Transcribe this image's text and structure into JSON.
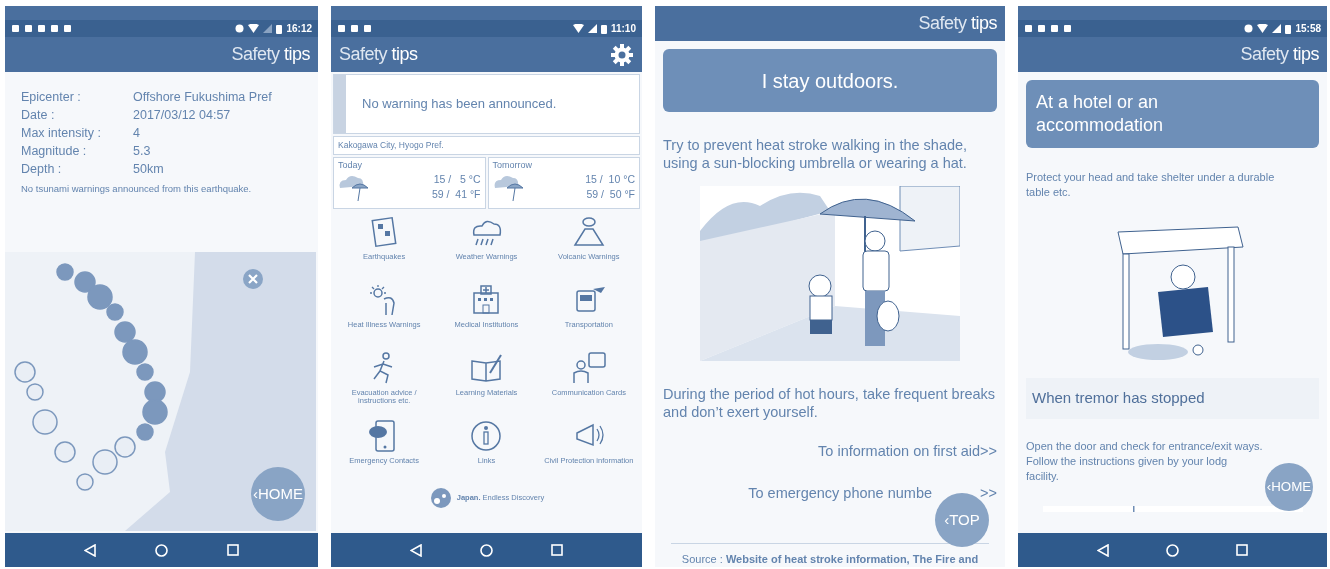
{
  "screens": [
    {
      "kind": "earthquake",
      "status_bar": {
        "time": "16:12"
      },
      "app_title": "Safety **tips**",
      "details": [
        {
          "label": "Epicenter :",
          "value": "Offshore Fukushima Pref"
        },
        {
          "label": "Date :",
          "value": "2017/03/12 04:57"
        },
        {
          "label": "Max intensity :",
          "value": "4"
        },
        {
          "label": "Magnitude :",
          "value": "5.3"
        },
        {
          "label": "Depth :",
          "value": "50km"
        }
      ],
      "note": "No tsunami warnings announced from this earthquake.",
      "map": {
        "kind": "picture"
      },
      "float_button": "‹HOME",
      "nav_bar": true
    },
    {
      "kind": "home",
      "status_bar": {
        "time": "11:10"
      },
      "app_title": "Safety **tips**",
      "warning": "No warning has been announced.",
      "location": "Kakogawa City, Hyogo Pref.",
      "forecast": [
        {
          "day": "Today",
          "celsius": "15 /   5 °C",
          "fahrenheit": "59 /  41 °F"
        },
        {
          "day": "Tomorrow",
          "celsius": "15 /  10 °C",
          "fahrenheit": "59 /  50 °F"
        }
      ],
      "menu": [
        {
          "label": "Earthquakes"
        },
        {
          "label": "Weather Warnings"
        },
        {
          "label": "Volcanic Warnings"
        },
        {
          "label": "Heat Illness Warnings"
        },
        {
          "label": "Medical Institutions"
        },
        {
          "label": "Transportation"
        },
        {
          "label": "Evacuation advice / instructions etc."
        },
        {
          "label": "Learning Materials"
        },
        {
          "label": "Communication Cards"
        },
        {
          "label": "Emergency Contacts"
        },
        {
          "label": "Links"
        },
        {
          "label": "Civil Protection information"
        }
      ],
      "footer_logo": "**Japan.** Endless Discovery",
      "nav_bar": true
    },
    {
      "kind": "tip",
      "app_title": "Safety **tips**",
      "heading": "I stay outdoors.",
      "blocks": [
        {
          "kind": "text",
          "text": "Try to prevent heat stroke walking in the shade, using a sun-blocking umbrella or wearing a hat."
        },
        {
          "kind": "picture"
        },
        {
          "kind": "text",
          "text": "During the period of hot hours, take frequent breaks and don’t exert yourself."
        },
        {
          "kind": "link",
          "text": "To information on first aid>>"
        },
        {
          "kind": "link",
          "text": "To emergency phone numbe",
          "tail": ">>"
        }
      ],
      "float_button": "‹TOP",
      "source": "Source : **Website of heat stroke information, The Fire and**"
    },
    {
      "kind": "tip",
      "status_bar": {
        "time": "15:58"
      },
      "app_title": "Safety **tips**",
      "heading": "At a hotel or an accommodation",
      "blocks": [
        {
          "kind": "text",
          "text": "Protect your head and take shelter under a durable table etc."
        },
        {
          "kind": "picture"
        },
        {
          "kind": "subheading",
          "text": "When tremor has stopped"
        },
        {
          "kind": "lines",
          "lines": [
            "Open the door and check for entrance/exit ways.",
            "Follow the instructions given by your lodg",
            "facility."
          ]
        },
        {
          "kind": "picture"
        }
      ],
      "float_button": "‹HOME",
      "nav_bar": true
    }
  ]
}
